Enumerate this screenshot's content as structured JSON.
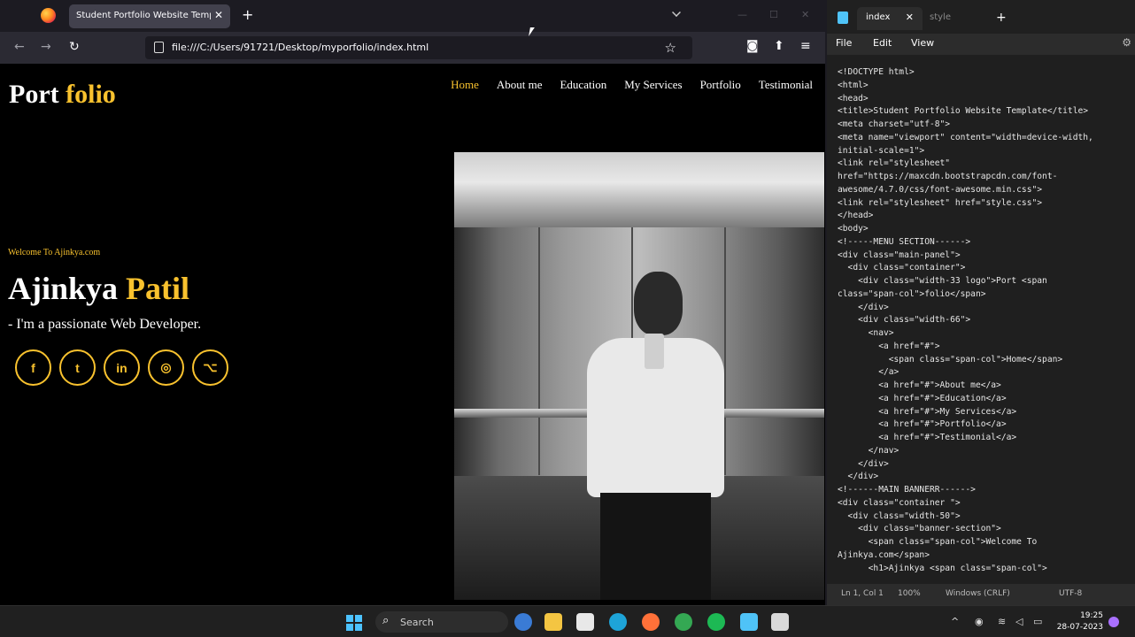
{
  "browser": {
    "tab_title": "Student Portfolio Website Template",
    "url": "file:///C:/Users/91721/Desktop/myporfolio/index.html"
  },
  "site": {
    "logo_main": "Port",
    "logo_accent": "folio",
    "menu": [
      "Home",
      "About me",
      "Education",
      "My Services",
      "Portfolio",
      "Testimonial"
    ],
    "welcome": "Welcome To Ajinkya.com",
    "name_first": "Ajinkya",
    "name_last": "Patil",
    "tagline": "- I'm a passionate Web Developer.",
    "socials": [
      {
        "label": "f",
        "icon": "facebook-icon"
      },
      {
        "label": "t",
        "icon": "twitter-icon"
      },
      {
        "label": "in",
        "icon": "linkedin-icon"
      },
      {
        "label": "◎",
        "icon": "instagram-icon"
      },
      {
        "label": "⌥",
        "icon": "github-icon"
      }
    ],
    "accent_color": "#f9c22e"
  },
  "notepad": {
    "tabs": [
      "index",
      "style"
    ],
    "menu": [
      "File",
      "Edit",
      "View"
    ],
    "code": "<!DOCTYPE html>\n<html>\n<head>\n<title>Student Portfolio Website Template</title>\n<meta charset=\"utf-8\">\n<meta name=\"viewport\" content=\"width=device-width,\ninitial-scale=1\">\n<link rel=\"stylesheet\"\nhref=\"https://maxcdn.bootstrapcdn.com/font-\nawesome/4.7.0/css/font-awesome.min.css\">\n<link rel=\"stylesheet\" href=\"style.css\">\n</head>\n<body>\n<!-----MENU SECTION------>\n<div class=\"main-panel\">\n  <div class=\"container\">\n    <div class=\"width-33 logo\">Port <span\nclass=\"span-col\">folio</span>\n    </div>\n    <div class=\"width-66\">\n      <nav>\n        <a href=\"#\">\n          <span class=\"span-col\">Home</span>\n        </a>\n        <a href=\"#\">About me</a>\n        <a href=\"#\">Education</a>\n        <a href=\"#\">My Services</a>\n        <a href=\"#\">Portfolio</a>\n        <a href=\"#\">Testimonial</a>\n      </nav>\n    </div>\n  </div>\n<!------MAIN BANNERR------>\n<div class=\"container \">\n  <div class=\"width-50\">\n    <div class=\"banner-section\">\n      <span class=\"span-col\">Welcome To\nAjinkya.com</span>\n      <h1>Ajinkya <span class=\"span-col\">",
    "status": {
      "position": "Ln 1, Col 1",
      "zoom": "100%",
      "line_ending": "Windows (CRLF)",
      "encoding": "UTF-8"
    }
  },
  "taskbar": {
    "search_placeholder": "Search",
    "time": "19:25",
    "date": "28-07-2023"
  }
}
